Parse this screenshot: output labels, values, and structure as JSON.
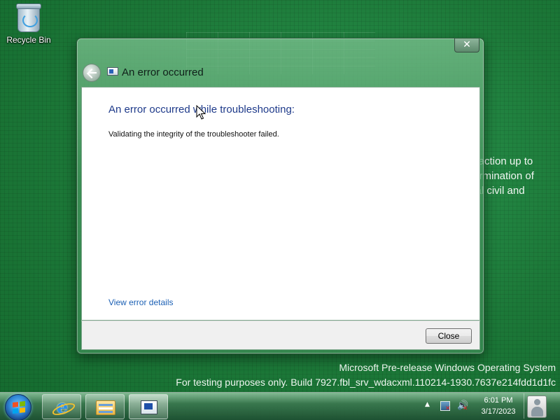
{
  "desktop": {
    "recycle_bin_label": "Recycle Bin",
    "background_text_lines": [
      "y action up to",
      "termination of",
      "tial civil and"
    ],
    "watermark_line1": "Microsoft Pre-release Windows Operating System",
    "watermark_line2": "For testing purposes only. Build 7927.fbl_srv_wdacxml.110214-1930.7637e214fdd1d1fc"
  },
  "dialog": {
    "title": "An error occurred",
    "close_glyph": "✕",
    "heading": "An error occurred while troubleshooting:",
    "message": "Validating the integrity of the troubleshooter failed.",
    "details_link": "View error details",
    "close_button": "Close"
  },
  "taskbar": {
    "time": "6:01 PM",
    "date": "3/17/2023",
    "tray_arrow": "▲",
    "sound_glyph": "🔊",
    "pinned": [
      "internet-explorer-icon",
      "windows-explorer-icon",
      "troubleshooter-app-icon"
    ]
  },
  "colors": {
    "desktop_bg": "#1f7a3c",
    "heading_blue": "#1e3a8a",
    "link_blue": "#1a5fb4"
  }
}
